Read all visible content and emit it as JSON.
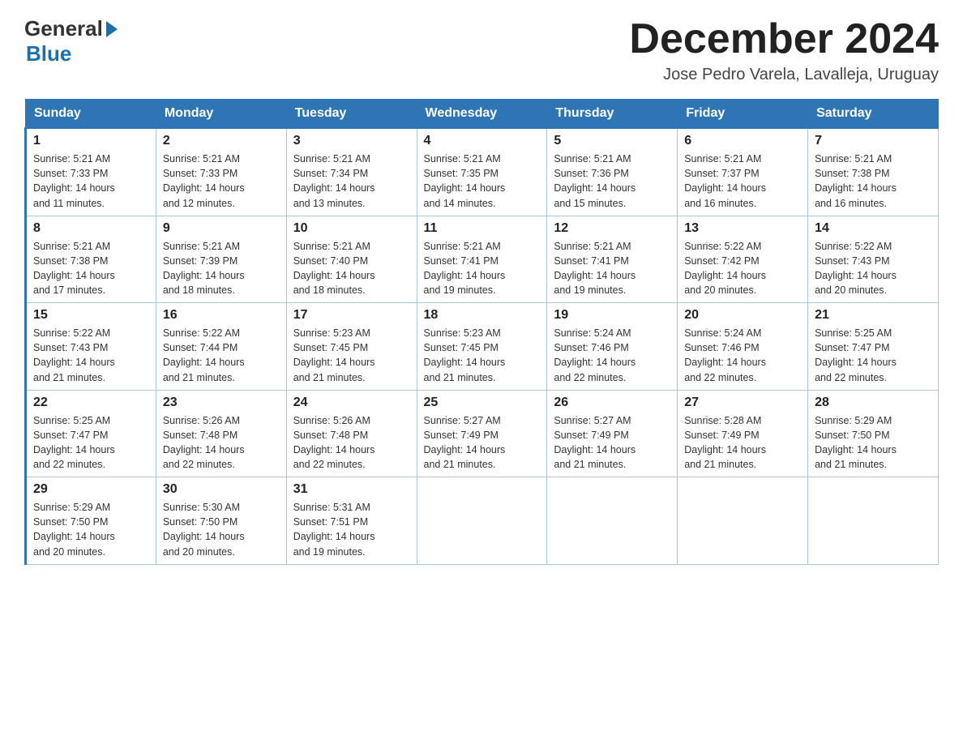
{
  "logo": {
    "text_general": "General",
    "text_blue": "Blue"
  },
  "header": {
    "month_year": "December 2024",
    "location": "Jose Pedro Varela, Lavalleja, Uruguay"
  },
  "days_of_week": [
    "Sunday",
    "Monday",
    "Tuesday",
    "Wednesday",
    "Thursday",
    "Friday",
    "Saturday"
  ],
  "weeks": [
    [
      {
        "day": "1",
        "sunrise": "5:21 AM",
        "sunset": "7:33 PM",
        "daylight": "14 hours and 11 minutes."
      },
      {
        "day": "2",
        "sunrise": "5:21 AM",
        "sunset": "7:33 PM",
        "daylight": "14 hours and 12 minutes."
      },
      {
        "day": "3",
        "sunrise": "5:21 AM",
        "sunset": "7:34 PM",
        "daylight": "14 hours and 13 minutes."
      },
      {
        "day": "4",
        "sunrise": "5:21 AM",
        "sunset": "7:35 PM",
        "daylight": "14 hours and 14 minutes."
      },
      {
        "day": "5",
        "sunrise": "5:21 AM",
        "sunset": "7:36 PM",
        "daylight": "14 hours and 15 minutes."
      },
      {
        "day": "6",
        "sunrise": "5:21 AM",
        "sunset": "7:37 PM",
        "daylight": "14 hours and 16 minutes."
      },
      {
        "day": "7",
        "sunrise": "5:21 AM",
        "sunset": "7:38 PM",
        "daylight": "14 hours and 16 minutes."
      }
    ],
    [
      {
        "day": "8",
        "sunrise": "5:21 AM",
        "sunset": "7:38 PM",
        "daylight": "14 hours and 17 minutes."
      },
      {
        "day": "9",
        "sunrise": "5:21 AM",
        "sunset": "7:39 PM",
        "daylight": "14 hours and 18 minutes."
      },
      {
        "day": "10",
        "sunrise": "5:21 AM",
        "sunset": "7:40 PM",
        "daylight": "14 hours and 18 minutes."
      },
      {
        "day": "11",
        "sunrise": "5:21 AM",
        "sunset": "7:41 PM",
        "daylight": "14 hours and 19 minutes."
      },
      {
        "day": "12",
        "sunrise": "5:21 AM",
        "sunset": "7:41 PM",
        "daylight": "14 hours and 19 minutes."
      },
      {
        "day": "13",
        "sunrise": "5:22 AM",
        "sunset": "7:42 PM",
        "daylight": "14 hours and 20 minutes."
      },
      {
        "day": "14",
        "sunrise": "5:22 AM",
        "sunset": "7:43 PM",
        "daylight": "14 hours and 20 minutes."
      }
    ],
    [
      {
        "day": "15",
        "sunrise": "5:22 AM",
        "sunset": "7:43 PM",
        "daylight": "14 hours and 21 minutes."
      },
      {
        "day": "16",
        "sunrise": "5:22 AM",
        "sunset": "7:44 PM",
        "daylight": "14 hours and 21 minutes."
      },
      {
        "day": "17",
        "sunrise": "5:23 AM",
        "sunset": "7:45 PM",
        "daylight": "14 hours and 21 minutes."
      },
      {
        "day": "18",
        "sunrise": "5:23 AM",
        "sunset": "7:45 PM",
        "daylight": "14 hours and 21 minutes."
      },
      {
        "day": "19",
        "sunrise": "5:24 AM",
        "sunset": "7:46 PM",
        "daylight": "14 hours and 22 minutes."
      },
      {
        "day": "20",
        "sunrise": "5:24 AM",
        "sunset": "7:46 PM",
        "daylight": "14 hours and 22 minutes."
      },
      {
        "day": "21",
        "sunrise": "5:25 AM",
        "sunset": "7:47 PM",
        "daylight": "14 hours and 22 minutes."
      }
    ],
    [
      {
        "day": "22",
        "sunrise": "5:25 AM",
        "sunset": "7:47 PM",
        "daylight": "14 hours and 22 minutes."
      },
      {
        "day": "23",
        "sunrise": "5:26 AM",
        "sunset": "7:48 PM",
        "daylight": "14 hours and 22 minutes."
      },
      {
        "day": "24",
        "sunrise": "5:26 AM",
        "sunset": "7:48 PM",
        "daylight": "14 hours and 22 minutes."
      },
      {
        "day": "25",
        "sunrise": "5:27 AM",
        "sunset": "7:49 PM",
        "daylight": "14 hours and 21 minutes."
      },
      {
        "day": "26",
        "sunrise": "5:27 AM",
        "sunset": "7:49 PM",
        "daylight": "14 hours and 21 minutes."
      },
      {
        "day": "27",
        "sunrise": "5:28 AM",
        "sunset": "7:49 PM",
        "daylight": "14 hours and 21 minutes."
      },
      {
        "day": "28",
        "sunrise": "5:29 AM",
        "sunset": "7:50 PM",
        "daylight": "14 hours and 21 minutes."
      }
    ],
    [
      {
        "day": "29",
        "sunrise": "5:29 AM",
        "sunset": "7:50 PM",
        "daylight": "14 hours and 20 minutes."
      },
      {
        "day": "30",
        "sunrise": "5:30 AM",
        "sunset": "7:50 PM",
        "daylight": "14 hours and 20 minutes."
      },
      {
        "day": "31",
        "sunrise": "5:31 AM",
        "sunset": "7:51 PM",
        "daylight": "14 hours and 19 minutes."
      },
      null,
      null,
      null,
      null
    ]
  ],
  "labels": {
    "sunrise": "Sunrise: ",
    "sunset": "Sunset: ",
    "daylight": "Daylight: "
  }
}
